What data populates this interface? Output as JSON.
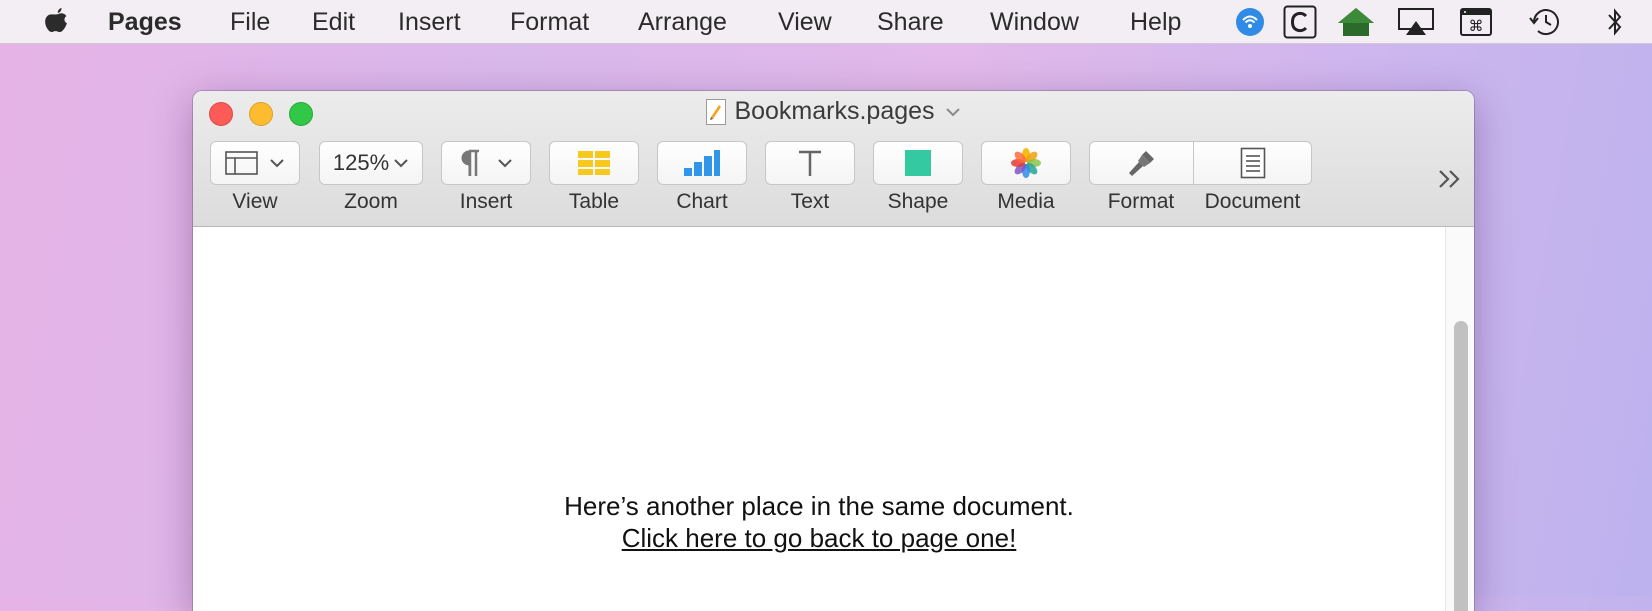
{
  "menubar": {
    "app_name": "Pages",
    "items": [
      "File",
      "Edit",
      "Insert",
      "Format",
      "Arrange",
      "View",
      "Share",
      "Window",
      "Help"
    ],
    "status_icons": [
      "wifi-icon",
      "c-app-icon",
      "home-icon",
      "airplay-icon",
      "command-keyboard-icon",
      "time-machine-icon",
      "bluetooth-icon"
    ]
  },
  "window": {
    "title": "Bookmarks.pages"
  },
  "toolbar": {
    "view_label": "View",
    "zoom_value": "125%",
    "zoom_label": "Zoom",
    "insert_label": "Insert",
    "table_label": "Table",
    "chart_label": "Chart",
    "text_label": "Text",
    "shape_label": "Shape",
    "media_label": "Media",
    "format_label": "Format",
    "document_label": "Document"
  },
  "document": {
    "line1": "Here’s another place in the same document.",
    "link": "Click here to go back to page one!"
  },
  "colors": {
    "accent_blue": "#2f8be6",
    "table_yellow": "#f7c81d",
    "chart_blue": "#2f96ea",
    "shape_green": "#34c9a0"
  }
}
